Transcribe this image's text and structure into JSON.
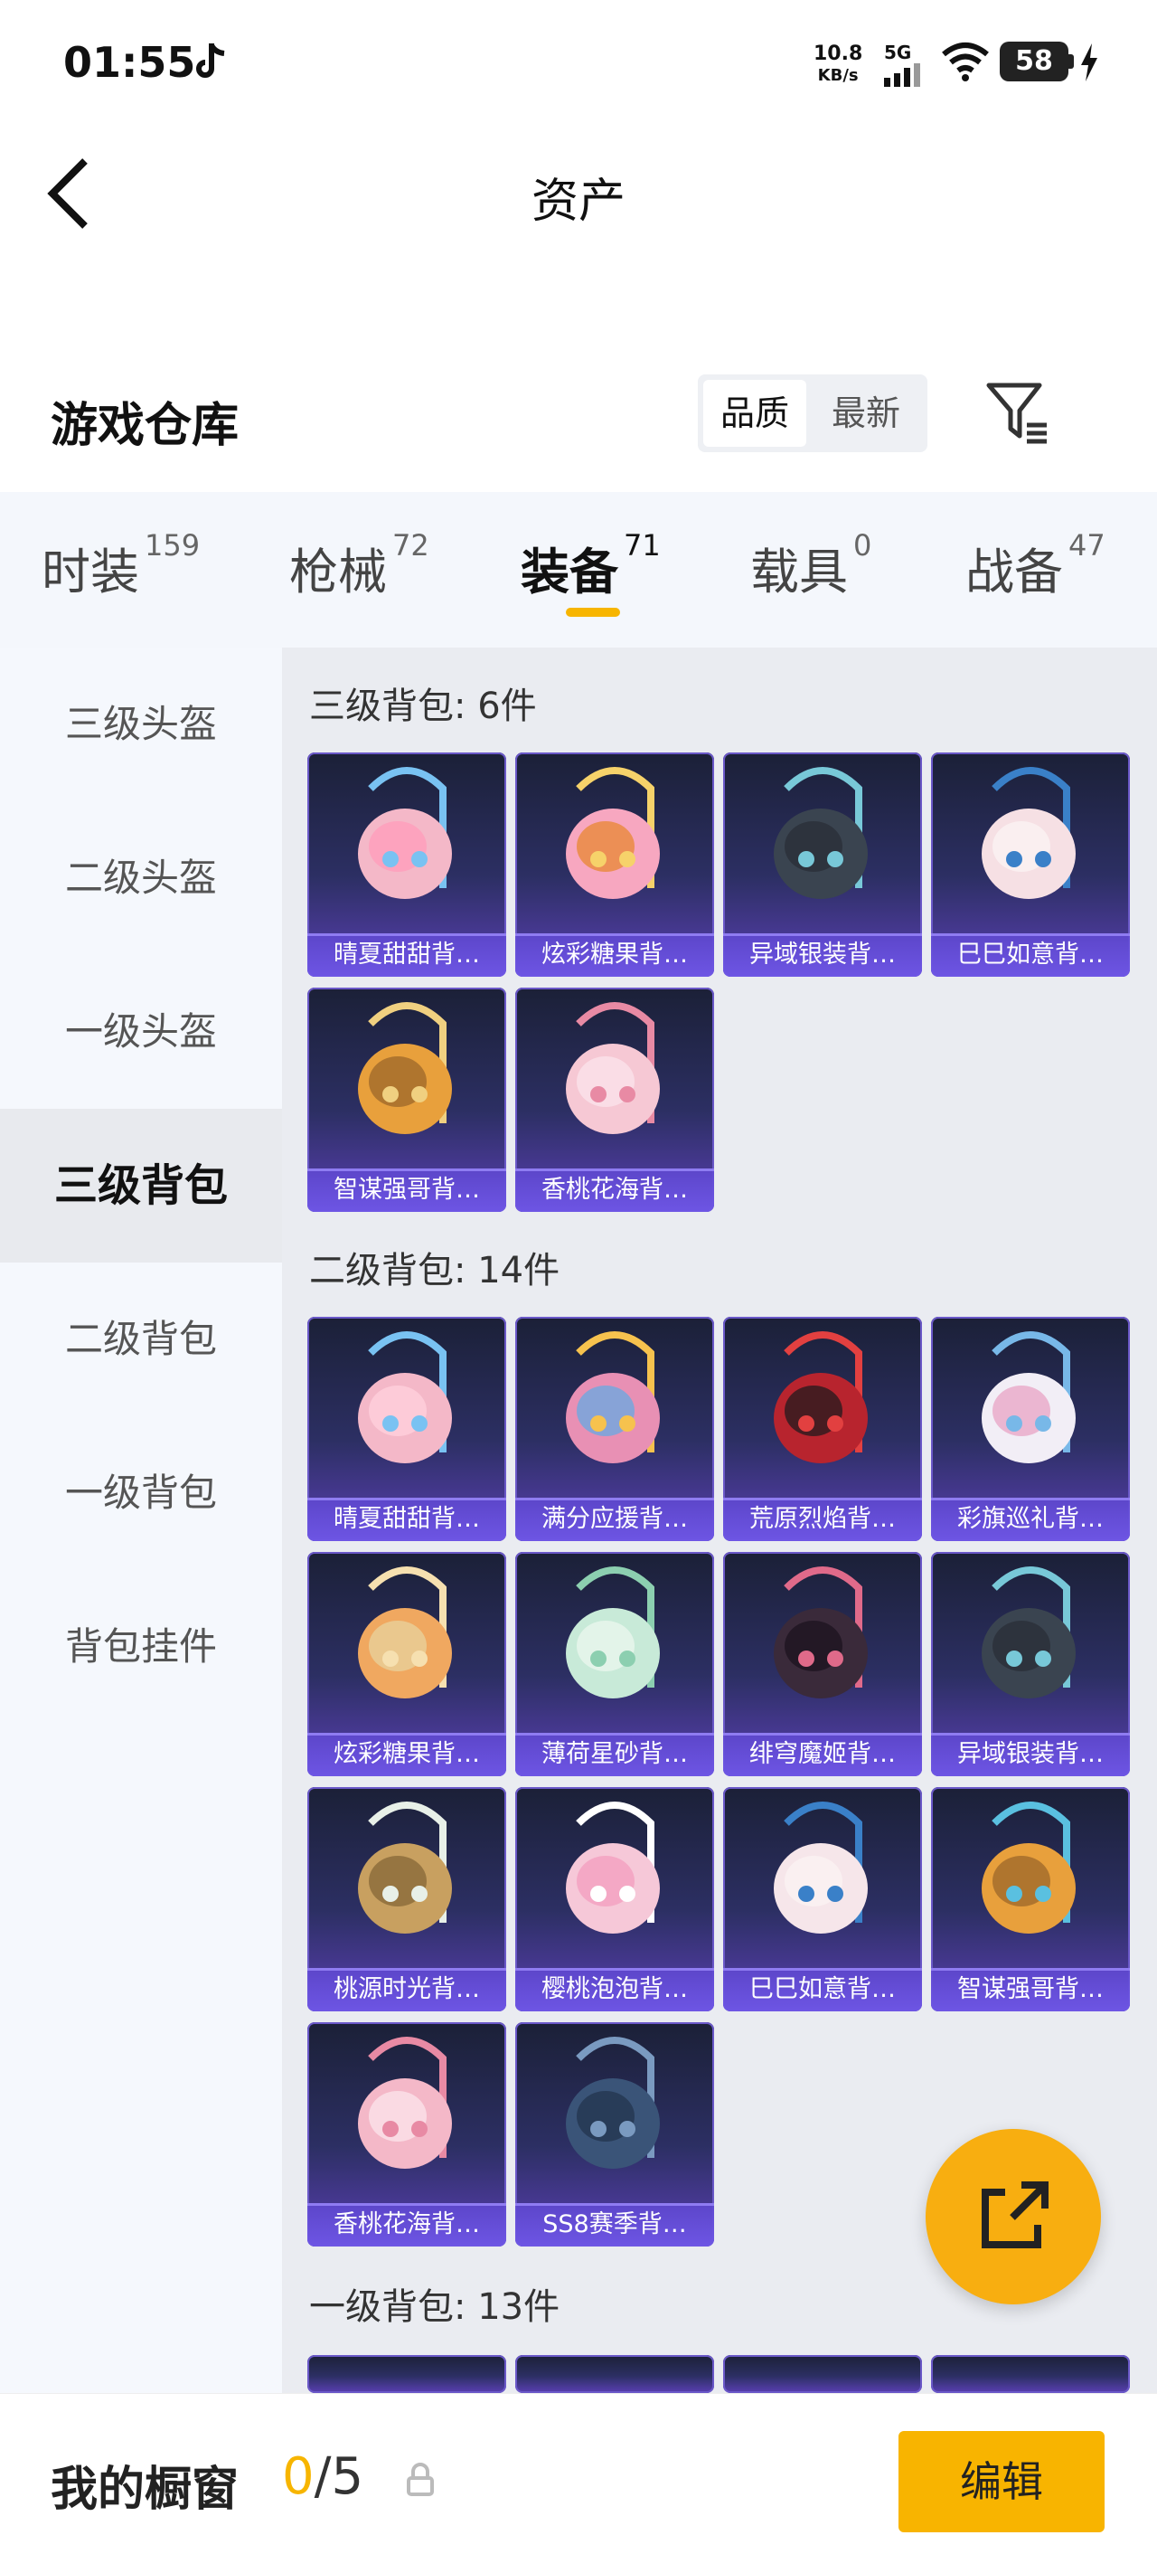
{
  "status_bar": {
    "time": "01:55",
    "net_speed_value": "10.8",
    "net_speed_unit": "KB/s",
    "network": "5G",
    "battery": "58"
  },
  "header": {
    "title": "资产",
    "warehouse_title": "游戏仓库"
  },
  "sort": {
    "quality": "品质",
    "newest": "最新"
  },
  "tabs": [
    {
      "label": "时装",
      "count": "159"
    },
    {
      "label": "枪械",
      "count": "72"
    },
    {
      "label": "装备",
      "count": "71"
    },
    {
      "label": "载具",
      "count": "0"
    },
    {
      "label": "战备",
      "count": "47"
    }
  ],
  "sidebar": {
    "items": [
      "三级头盔",
      "二级头盔",
      "一级头盔",
      "三级背包",
      "二级背包",
      "一级背包",
      "背包挂件"
    ],
    "active": "三级背包"
  },
  "sections": [
    {
      "title": "三级背包: 6件",
      "items": [
        "晴夏甜甜背…",
        "炫彩糖果背…",
        "异域银装背…",
        "巳巳如意背…",
        "智谋强哥背…",
        "香桃花海背…"
      ]
    },
    {
      "title": "二级背包: 14件",
      "items": [
        "晴夏甜甜背…",
        "满分应援背…",
        "荒原烈焰背…",
        "彩旗巡礼背…",
        "炫彩糖果背…",
        "薄荷星砂背…",
        "绯穹魔姬背…",
        "异域银装背…",
        "桃源时光背…",
        "樱桃泡泡背…",
        "巳巳如意背…",
        "智谋强哥背…",
        "香桃花海背…",
        "SS8赛季背…"
      ]
    },
    {
      "title": "一级背包: 13件",
      "items": []
    }
  ],
  "bottom": {
    "showcase_label": "我的橱窗",
    "count_current": "0",
    "count_total": "/5",
    "edit": "编辑"
  }
}
